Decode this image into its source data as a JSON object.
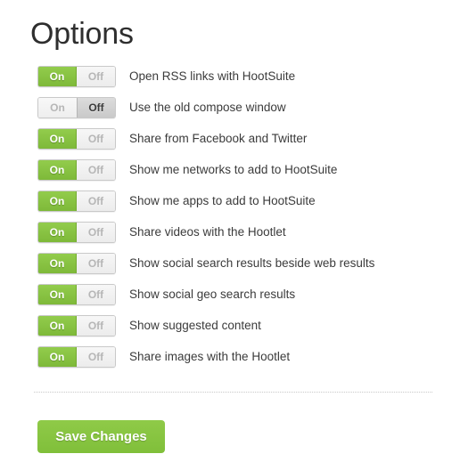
{
  "page": {
    "title": "Options"
  },
  "toggle": {
    "on_label": "On",
    "off_label": "Off"
  },
  "colors": {
    "accent_green": "#86c440",
    "label_text": "#3b3b3b",
    "title_text": "#2e2e2e",
    "divider": "#c8c8c8",
    "toggle_inactive_text": "#b3b3b3",
    "toggle_off_active_bg": "#d2d2d2"
  },
  "options": [
    {
      "label": "Open RSS links with HootSuite",
      "state": "on"
    },
    {
      "label": "Use the old compose window",
      "state": "off"
    },
    {
      "label": "Share from Facebook and Twitter",
      "state": "on"
    },
    {
      "label": "Show me networks to add to HootSuite",
      "state": "on"
    },
    {
      "label": "Show me apps to add to HootSuite",
      "state": "on"
    },
    {
      "label": "Share videos with the Hootlet",
      "state": "on"
    },
    {
      "label": "Show social search results beside web results",
      "state": "on"
    },
    {
      "label": "Show social geo search results",
      "state": "on"
    },
    {
      "label": "Show suggested content",
      "state": "on"
    },
    {
      "label": "Share images with the Hootlet",
      "state": "on"
    }
  ],
  "footer": {
    "save_label": "Save Changes"
  }
}
